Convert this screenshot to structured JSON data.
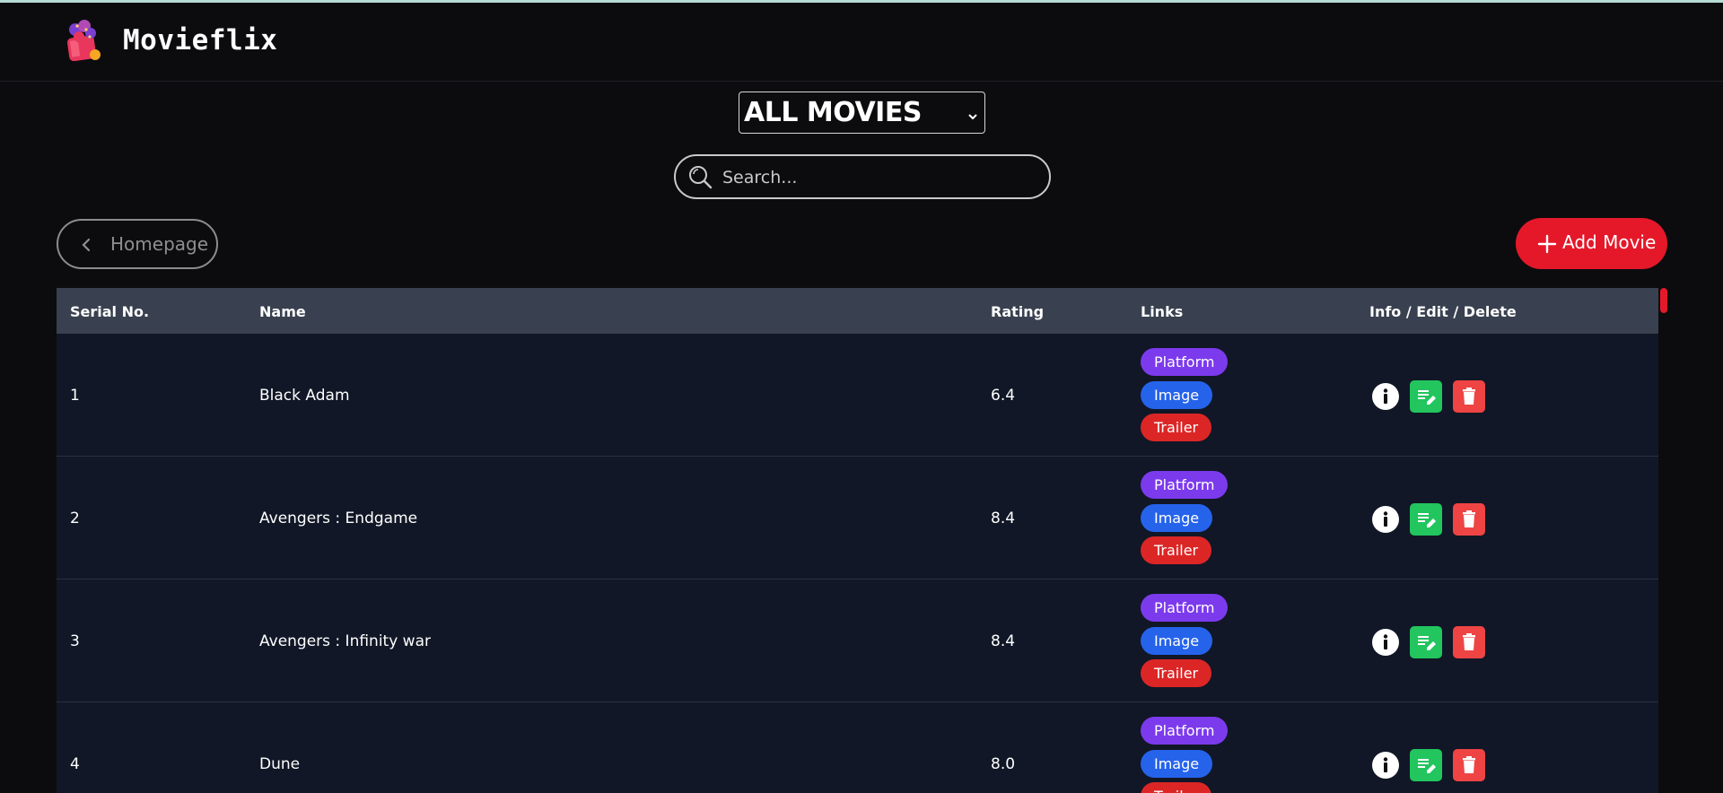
{
  "app": {
    "brand": "Movieflix"
  },
  "filter": {
    "selected": "ALL MOVIES"
  },
  "search": {
    "placeholder": "Search..."
  },
  "nav": {
    "homepage_label": "Homepage",
    "add_label": "Add Movie"
  },
  "table": {
    "headers": [
      "Serial No.",
      "Name",
      "Rating",
      "Links",
      "Info / Edit / Delete"
    ],
    "link_labels": {
      "platform": "Platform",
      "image": "Image",
      "trailer": "Trailer"
    },
    "rows": [
      {
        "serial": "1",
        "name": "Black Adam",
        "rating": "6.4"
      },
      {
        "serial": "2",
        "name": "Avengers : Endgame",
        "rating": "8.4"
      },
      {
        "serial": "3",
        "name": "Avengers : Infinity war",
        "rating": "8.4"
      },
      {
        "serial": "4",
        "name": "Dune",
        "rating": "8.0"
      }
    ]
  },
  "colors": {
    "accent": "#e5182a",
    "platform": "#7c3aed",
    "image": "#2563eb",
    "trailer": "#dc2626",
    "edit": "#22c55e",
    "delete": "#ef4444",
    "header_row": "#394150",
    "row_bg": "#111726"
  },
  "icons": [
    "popcorn-logo-icon",
    "chevron-down-icon",
    "search-icon",
    "chevron-left-icon",
    "plus-icon",
    "info-icon",
    "edit-icon",
    "trash-icon"
  ]
}
